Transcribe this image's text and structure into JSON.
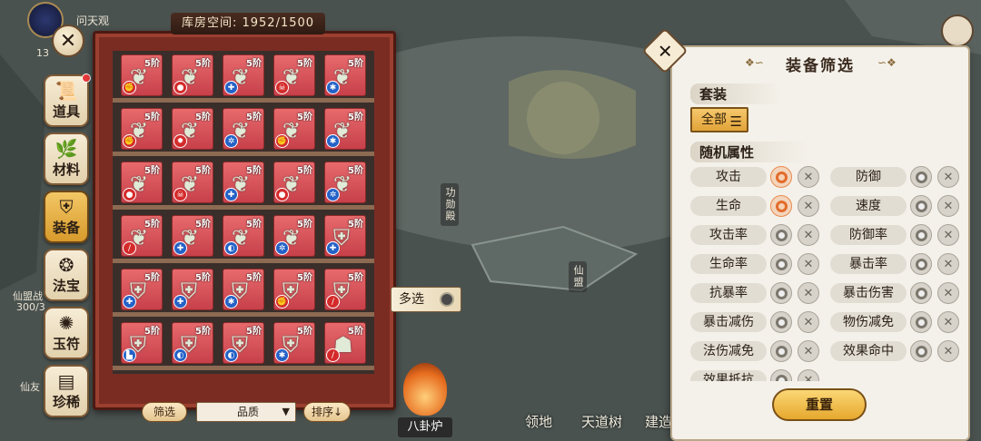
{
  "background": {
    "top_left_text": "问天观",
    "map_labels": [
      "功勋殿",
      "仙盟"
    ],
    "left_fragments": [
      "仙盟战",
      "300/3",
      "仙友",
      "13"
    ]
  },
  "categories": [
    {
      "label": "道具",
      "icon": "scroll-icon",
      "badge": true,
      "active": false
    },
    {
      "label": "材料",
      "icon": "herb-icon",
      "badge": false,
      "active": false
    },
    {
      "label": "装备",
      "icon": "armor-icon",
      "badge": false,
      "active": true
    },
    {
      "label": "法宝",
      "icon": "treasure-icon",
      "badge": false,
      "active": false
    },
    {
      "label": "玉符",
      "icon": "talisman-icon",
      "badge": false,
      "active": false
    },
    {
      "label": "珍稀",
      "icon": "chest-icon",
      "badge": false,
      "active": false
    }
  ],
  "storage": {
    "label": "库房空间:",
    "value": "1952/1500",
    "tier_label": "5阶",
    "rows": [
      [
        [
          "wing-icon",
          "red",
          "fist-icon"
        ],
        [
          "wing-icon",
          "red",
          "drop-icon"
        ],
        [
          "wing-icon",
          "blue",
          "shield-icon"
        ],
        [
          "wing-icon",
          "red",
          "skull-icon"
        ],
        [
          "wing-icon",
          "blue",
          "star-icon"
        ]
      ],
      [
        [
          "wing-icon",
          "red",
          "fist-icon"
        ],
        [
          "wing-icon",
          "red",
          "flame-icon"
        ],
        [
          "wing-icon",
          "blue",
          "burst-icon"
        ],
        [
          "wing-icon",
          "red",
          "fist-icon"
        ],
        [
          "wing-icon",
          "blue",
          "star-icon"
        ]
      ],
      [
        [
          "wing-icon",
          "red",
          "drop-icon"
        ],
        [
          "wing-icon",
          "red",
          "skull-icon"
        ],
        [
          "wing-icon",
          "blue",
          "cross-icon"
        ],
        [
          "wing-icon",
          "red",
          "drop-icon"
        ],
        [
          "wing-icon",
          "blue",
          "burst-icon"
        ]
      ],
      [
        [
          "wing-icon",
          "red",
          "sword-icon"
        ],
        [
          "wing-icon",
          "blue",
          "cross-icon"
        ],
        [
          "wing-icon",
          "blue",
          "moon-icon"
        ],
        [
          "wing-icon",
          "blue",
          "burst-icon"
        ],
        [
          "armor-icon",
          "blue",
          "shield-icon"
        ]
      ],
      [
        [
          "armor-icon",
          "blue",
          "cross-icon"
        ],
        [
          "armor-icon",
          "blue",
          "cross-icon"
        ],
        [
          "armor-icon",
          "blue",
          "star-icon"
        ],
        [
          "armor-icon",
          "red",
          "fist-icon"
        ],
        [
          "armor-icon",
          "red",
          "sword-icon"
        ]
      ],
      [
        [
          "armor-icon",
          "blue",
          "boot-icon"
        ],
        [
          "armor-icon",
          "blue",
          "moon-icon"
        ],
        [
          "armor-icon",
          "blue",
          "moon-icon"
        ],
        [
          "armor-icon",
          "blue",
          "star-icon"
        ],
        [
          "helmet-icon",
          "red",
          "sword-icon"
        ]
      ]
    ]
  },
  "controls": {
    "filter_label": "筛选",
    "sort_value": "品质",
    "sort_label": "排序",
    "multi_select_label": "多选"
  },
  "bagua": {
    "label": "八卦炉"
  },
  "bottom_nav": [
    "领地",
    "天道树",
    "建造"
  ],
  "filter_panel": {
    "title": "装备筛选",
    "set_label": "套装",
    "all_label": "全部",
    "random_attr_label": "随机属性",
    "attributes": [
      [
        {
          "name": "攻击",
          "selected": true
        },
        {
          "name": "防御",
          "selected": false
        }
      ],
      [
        {
          "name": "生命",
          "selected": true
        },
        {
          "name": "速度",
          "selected": false
        }
      ],
      [
        {
          "name": "攻击率",
          "selected": false
        },
        {
          "name": "防御率",
          "selected": false
        }
      ],
      [
        {
          "name": "生命率",
          "selected": false
        },
        {
          "name": "暴击率",
          "selected": false
        }
      ],
      [
        {
          "name": "抗暴率",
          "selected": false
        },
        {
          "name": "暴击伤害",
          "selected": false
        }
      ],
      [
        {
          "name": "暴击减伤",
          "selected": false
        },
        {
          "name": "物伤减免",
          "selected": false
        }
      ],
      [
        {
          "name": "法伤减免",
          "selected": false
        },
        {
          "name": "效果命中",
          "selected": false
        }
      ],
      [
        {
          "name": "效果抵抗",
          "selected": false
        }
      ]
    ],
    "reset_label": "重置"
  },
  "colors": {
    "cabinet": "#7a2c22",
    "slot": "#d95458",
    "accent_gold": "#e6a82e",
    "selected_orange": "#e26c2c"
  }
}
